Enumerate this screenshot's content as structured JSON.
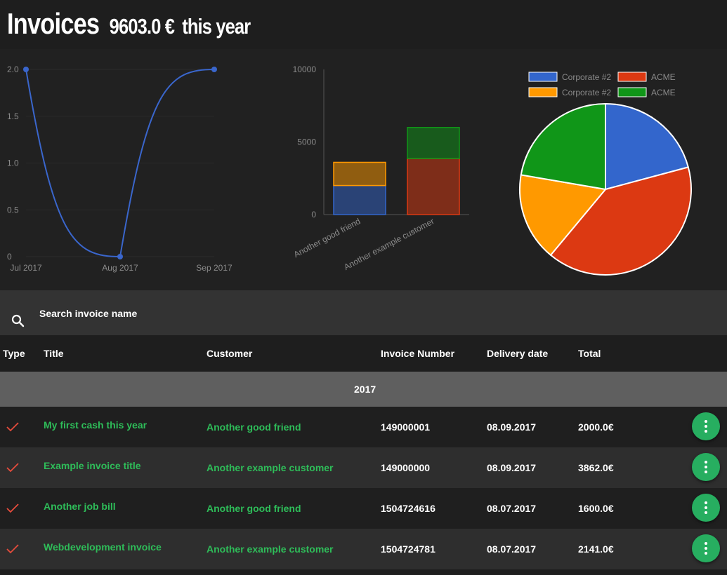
{
  "header": {
    "title": "Invoices",
    "total": "9603.0 €",
    "suffix": "this year"
  },
  "charts": {
    "colors": {
      "blue": "#3366cc",
      "red": "#dc3912",
      "orange": "#ff9900",
      "green": "#109618",
      "line": "#3a66cc"
    }
  },
  "chart_data": [
    {
      "type": "line",
      "x": [
        "Jul 2017",
        "Aug 2017",
        "Sep 2017"
      ],
      "series": [
        {
          "values": [
            2.0,
            0,
            2.0
          ]
        }
      ],
      "yticks": [
        "0",
        "0.5",
        "1.0",
        "1.5",
        "2.0"
      ],
      "ylim": [
        0,
        2.0
      ],
      "smooth": true
    },
    {
      "type": "bar",
      "stacked": true,
      "categories": [
        "Another good friend",
        "Another example customer"
      ],
      "series": [
        {
          "values": [
            2000,
            3862
          ],
          "color_bottom": [
            "#3366cc",
            "#dc3912"
          ]
        },
        {
          "values": [
            1600,
            2141
          ],
          "color_top": [
            "#ff9900",
            "#109618"
          ]
        }
      ],
      "yticks": [
        "0",
        "5000",
        "10000"
      ],
      "ylim": [
        0,
        10000
      ]
    },
    {
      "type": "pie",
      "legend": [
        {
          "name": "Corporate #2",
          "color": "#3366cc"
        },
        {
          "name": "ACME",
          "color": "#dc3912"
        },
        {
          "name": "Corporate #2",
          "color": "#ff9900"
        },
        {
          "name": "ACME",
          "color": "#109618"
        }
      ],
      "values": [
        2000,
        3862,
        1600,
        2141
      ],
      "legend_position": "top"
    }
  ],
  "search": {
    "placeholder": "Search invoice name"
  },
  "table": {
    "headers": {
      "type": "Type",
      "title": "Title",
      "customer": "Customer",
      "number": "Invoice Number",
      "delivery": "Delivery date",
      "total": "Total"
    },
    "group": "2017",
    "rows": [
      {
        "title": "My first cash this year",
        "customer": "Another good friend",
        "number": "149000001",
        "date": "08.09.2017",
        "total": "2000.0€"
      },
      {
        "title": "Example invoice title",
        "customer": "Another example customer",
        "number": "149000000",
        "date": "08.09.2017",
        "total": "3862.0€"
      },
      {
        "title": "Another job bill",
        "customer": "Another good friend",
        "number": "1504724616",
        "date": "08.07.2017",
        "total": "1600.0€"
      },
      {
        "title": "Webdevelopment invoice",
        "customer": "Another example customer",
        "number": "1504724781",
        "date": "08.07.2017",
        "total": "2141.0€"
      }
    ]
  }
}
